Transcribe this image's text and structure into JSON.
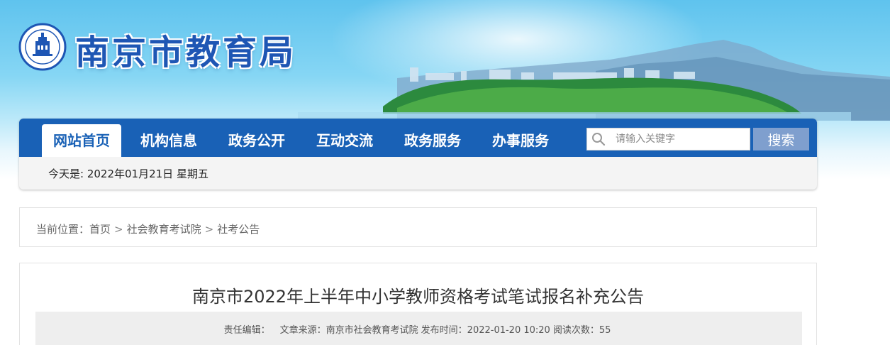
{
  "header": {
    "site_title": "南京市教育局",
    "logo_icon": "nanjing-education-seal-icon",
    "brand_color": "#1961b6"
  },
  "nav": {
    "items": [
      {
        "label": "网站首页",
        "active": true
      },
      {
        "label": "机构信息",
        "active": false
      },
      {
        "label": "政务公开",
        "active": false
      },
      {
        "label": "互动交流",
        "active": false
      },
      {
        "label": "政务服务",
        "active": false
      },
      {
        "label": "办事服务",
        "active": false
      }
    ],
    "search": {
      "placeholder": "请输入关键字",
      "button_label": "搜索"
    },
    "date_text": "今天是: 2022年01月21日 星期五"
  },
  "breadcrumb": {
    "prefix": "当前位置：",
    "items": [
      "首页",
      "社会教育考试院",
      "社考公告"
    ],
    "separator": ">"
  },
  "article": {
    "title": "南京市2022年上半年中小学教师资格考试笔试报名补充公告",
    "meta": {
      "editor_label": "责任编辑：",
      "source_label": "文章来源：",
      "source": "南京市社会教育考试院",
      "published_label": "发布时间：",
      "published": "2022-01-20 10:20",
      "views_label": "阅读次数：",
      "views": "55"
    }
  }
}
